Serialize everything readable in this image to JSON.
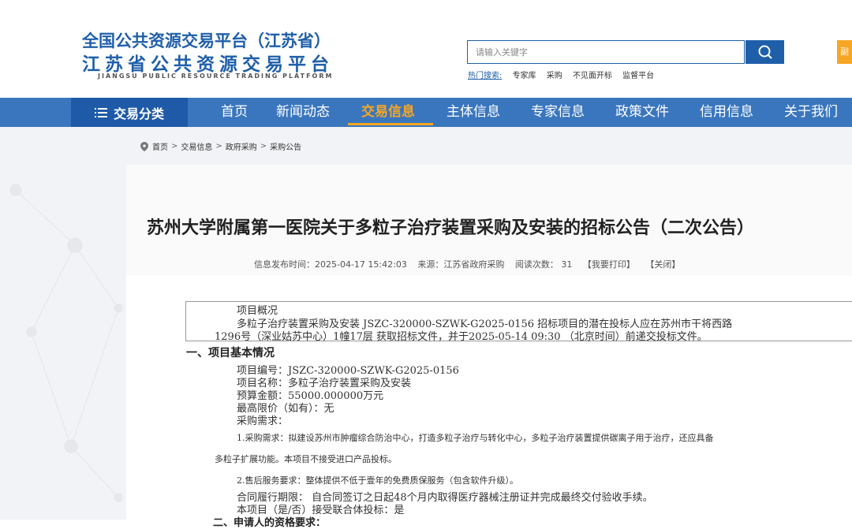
{
  "header": {
    "logo_cn_line1": "全国公共资源交易平台（江苏省）",
    "logo_cn_line2": "江苏省公共资源交易平台",
    "logo_en": "JIANGSU PUBLIC RESOURCE TRADING PLATFORM",
    "search_placeholder": "请输入关键字",
    "hot_label": "热门搜索:",
    "hot_items": [
      "专家库",
      "采购",
      "不见面开标",
      "监督平台"
    ],
    "orange_tab_label": "副"
  },
  "nav": {
    "category_label": "交易分类",
    "items": [
      "首页",
      "新闻动态",
      "交易信息",
      "主体信息",
      "专家信息",
      "政策文件",
      "信用信息",
      "关于我们"
    ],
    "active_index": 2
  },
  "breadcrumb": [
    "首页",
    "交易信息",
    "政府采购",
    "采购公告"
  ],
  "article": {
    "title": "苏州大学附属第一医院关于多粒子治疗装置采购及安装的招标公告（二次公告）",
    "meta_publish": "信息发布时间：2025-04-17 15:42:03",
    "meta_source": "来源：江苏省政府采购",
    "meta_reads": "阅读次数： 31",
    "meta_print": "【我要打印】",
    "meta_close": "【关闭】",
    "summary_heading": "项目概况",
    "summary_line1": "多粒子治疗装置采购及安装 JSZC-320000-SZWK-G2025-0156 招标项目的潜在投标人应在苏州市干将西路",
    "summary_line2": "1296号（深业姑苏中心）1幢17层 获取招标文件，并于2025-05-14 09:30 （北京时间）前递交投标文件。",
    "section1_title": "一、项目基本情况",
    "project_no": "项目编号：JSZC-320000-SZWK-G2025-0156",
    "project_name": "项目名称：多粒子治疗装置采购及安装",
    "budget": "预算金额：55000.000000万元",
    "max_price": "最高限价（如有）：无",
    "requirement_heading": "采购需求：",
    "req1_line1": "1.采购需求：拟建设苏州市肿瘤综合防治中心，打造多粒子治疗与转化中心，多粒子治疗装置提供碳离子用于治疗，还应具备",
    "req1_line2": "多粒子扩展功能。本项目不接受进口产品投标。",
    "req2": "2.售后服务要求：整体提供不低于壹年的免费质保服务（包含软件升级）。",
    "contract_period": "合同履行期限： 自合同签订之日起48个月内取得医疗器械注册证并完成最终交付验收手续。",
    "consortium": "本项目（是/否）接受联合体投标：是",
    "section2_partial": "二、申请人的资格要求："
  }
}
